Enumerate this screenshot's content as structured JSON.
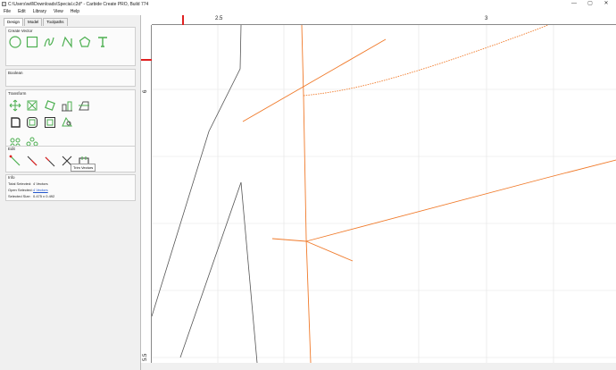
{
  "window": {
    "title": "C:\\Users\\will\\Downloads\\Special.c2d* - Carbide Create PRO, Build 774",
    "minimize_glyph": "—",
    "maximize_glyph": "▢",
    "close_glyph": "✕"
  },
  "menu": [
    "File",
    "Edit",
    "Library",
    "View",
    "Help"
  ],
  "tabs": [
    "Design",
    "Model",
    "Toolpaths"
  ],
  "sections": {
    "create_vector": "Create Vector",
    "boolean": "Boolean",
    "transform": "Transform",
    "edit": "Edit",
    "info": "Info"
  },
  "tooltip": "Trim Vectors",
  "info": {
    "total_selected_label": "Total Selected:",
    "total_selected_value": "4 Vectors",
    "open_selected_label": "Open Selected:",
    "open_selected_value": "4 Vectors",
    "selected_size_label": "Selected Size:",
    "selected_size_value": "0.475 x 0.492"
  },
  "ruler": {
    "top_labels": [
      "2.5",
      "3"
    ],
    "left_labels": [
      "6",
      "5.5"
    ]
  },
  "colors": {
    "accent_green": "#4caf50",
    "vector_orange": "#f07a2a",
    "vector_gray": "#555555",
    "ruler_marker": "#e02020"
  },
  "icons": {
    "create_vector": [
      "circle-icon",
      "rectangle-icon",
      "curve-icon",
      "polyline-icon",
      "polygon-icon",
      "text-icon"
    ],
    "transform_row1": [
      "move-icon",
      "scale-icon",
      "rotate-icon",
      "align-icon",
      "mirror-icon"
    ],
    "transform_row2": [
      "fillet-icon",
      "offset-icon",
      "outline-icon",
      "node-edit-icon"
    ],
    "transform_row3": [
      "circular-array-icon",
      "linear-array-icon"
    ],
    "edit": [
      "join-icon",
      "extend-icon",
      "trim-icon",
      "cut-icon",
      "trim-vectors-icon"
    ]
  }
}
